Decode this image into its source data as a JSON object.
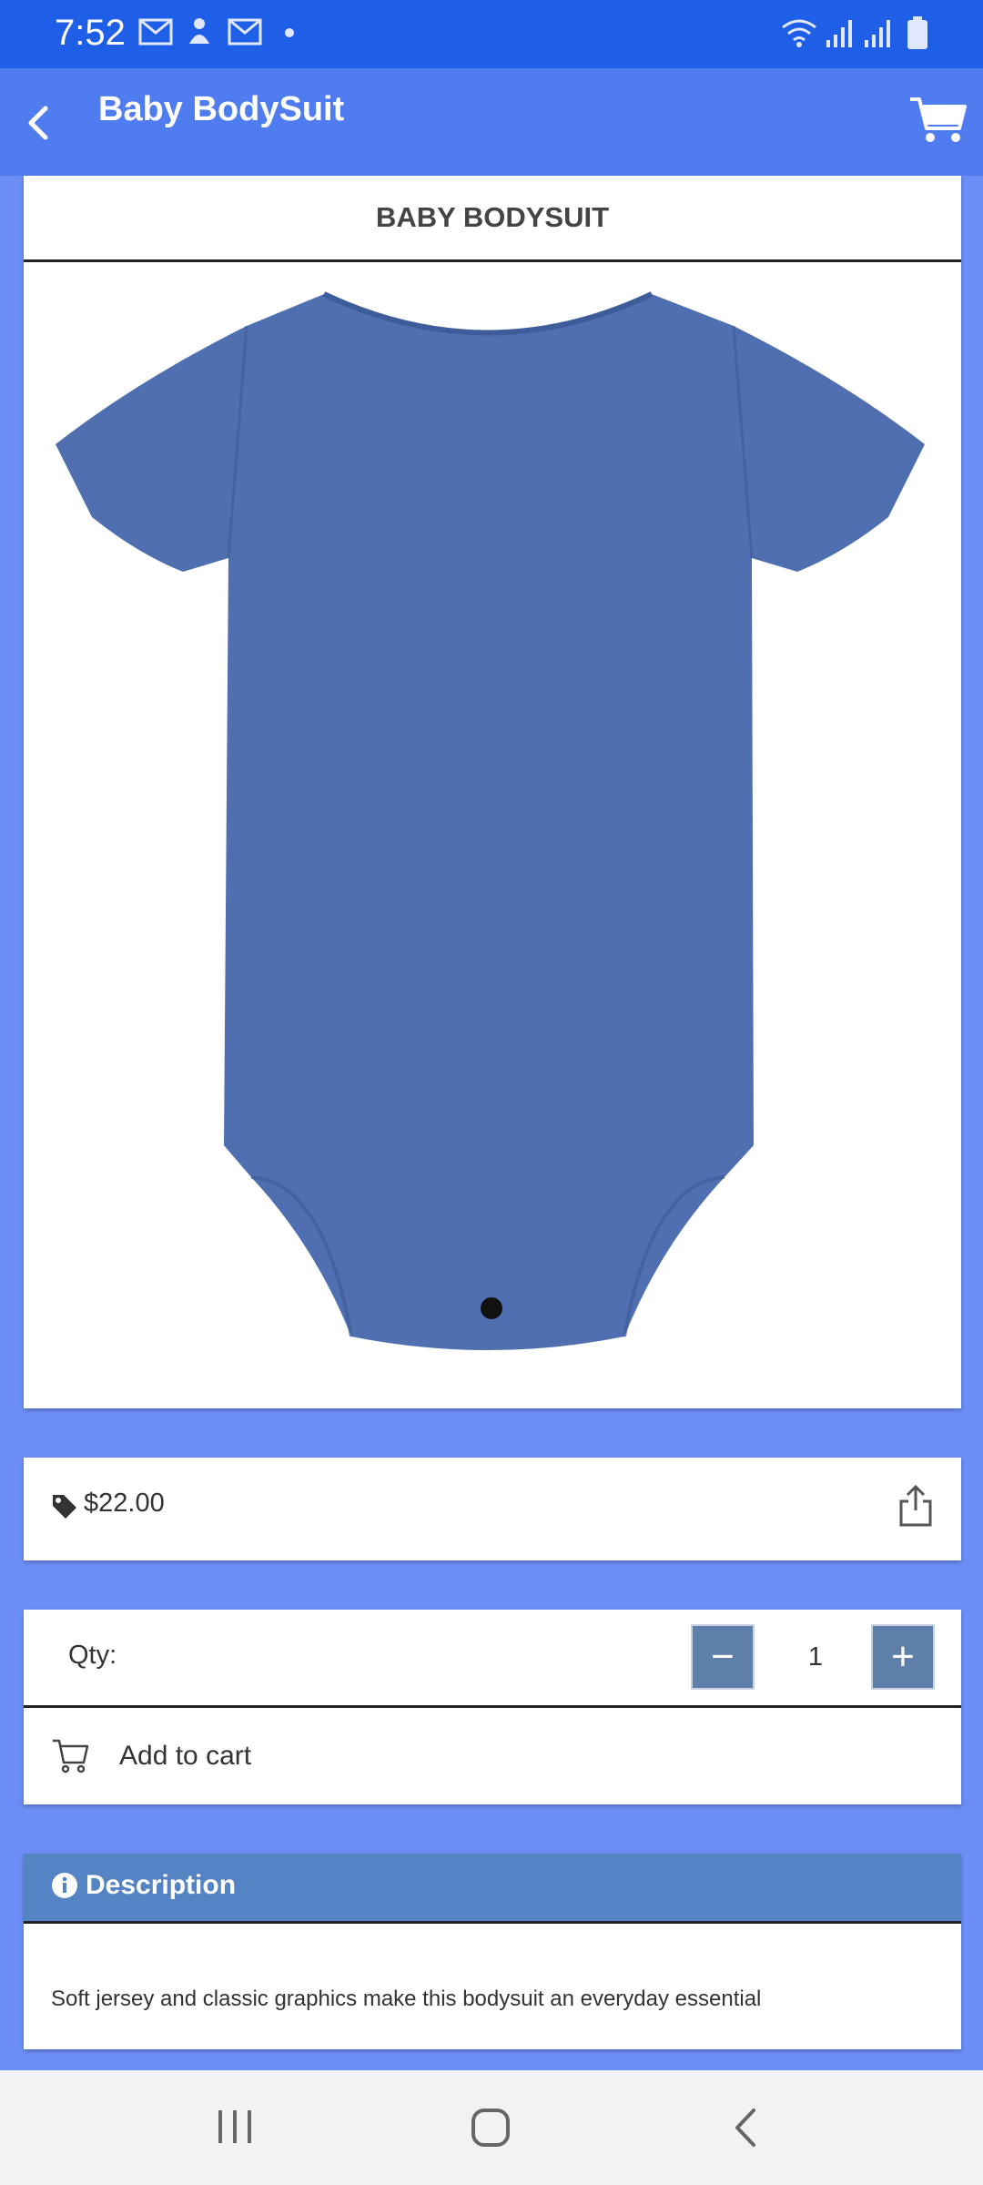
{
  "status": {
    "time": "7:52",
    "icons": [
      "gmail-icon",
      "notification-icon",
      "gmail-icon",
      "dot-icon",
      "wifi-icon",
      "signal-icon",
      "signal-icon",
      "battery-icon"
    ]
  },
  "appbar": {
    "title": "Baby BodySuit",
    "back_icon": "chevron-left-icon",
    "cart_icon": "cart-icon"
  },
  "product": {
    "title": "BABY BODYSUIT",
    "image_alt": "blue baby bodysuit",
    "color": "#4f6fb0"
  },
  "price": {
    "value": "$22.00",
    "tag_icon": "price-tag-icon",
    "share_icon": "share-icon"
  },
  "quantity": {
    "label": "Qty:",
    "value": "1",
    "minus": "−",
    "plus": "+"
  },
  "cart_action": {
    "label": "Add to cart"
  },
  "description": {
    "heading": "Description",
    "text": "Soft jersey and classic graphics make this bodysuit an everyday essential"
  },
  "colors": {
    "statusbar": "#1f5ee6",
    "appbar": "#4f7cef",
    "background": "#6b8df5",
    "qty_button": "#5e7fa8",
    "description_header": "#5584c4"
  }
}
